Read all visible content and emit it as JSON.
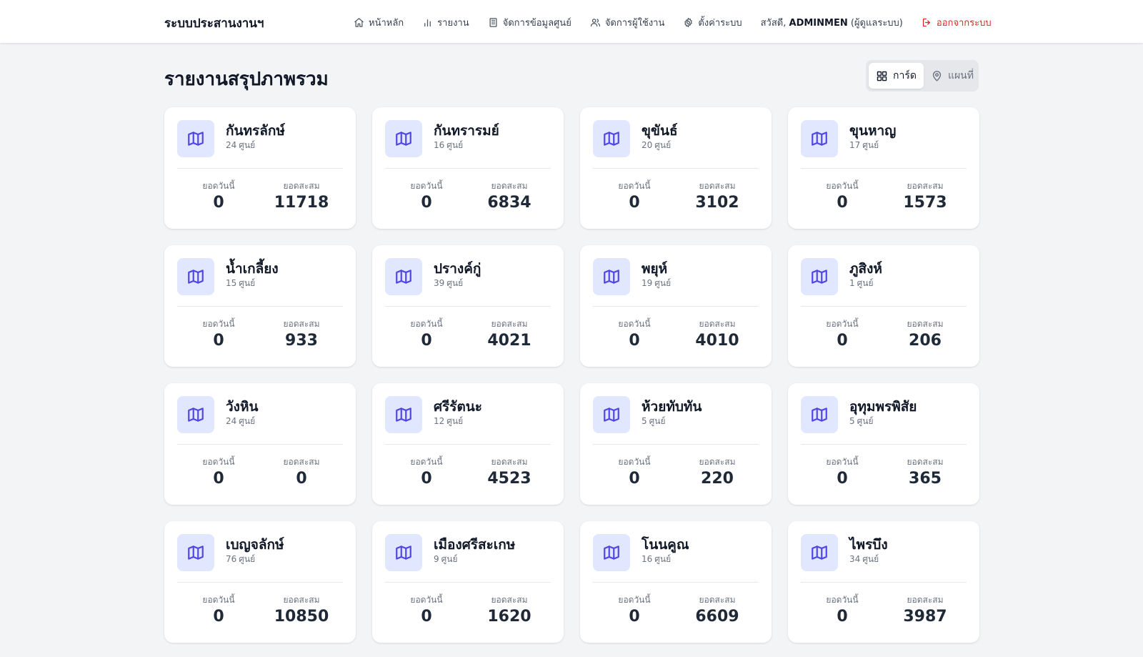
{
  "app": {
    "title": "ระบบประสานงานฯ"
  },
  "nav": {
    "home": "หน้าหลัก",
    "reports": "รายงาน",
    "manage_centers": "จัดการข้อมูลศูนย์",
    "manage_users": "จัดการผู้ใช้งาน",
    "settings": "ตั้งค่าระบบ",
    "greeting_prefix": "สวัสดี,",
    "username": "ADMINMEN",
    "role": "(ผู้ดูแลระบบ)",
    "logout": "ออกจากระบบ"
  },
  "page": {
    "title": "รายงานสรุปภาพรวม",
    "view_card": "การ์ด",
    "view_map": "แผนที่",
    "label_today": "ยอดวันนี้",
    "label_total": "ยอดสะสม",
    "unit_center": "ศูนย์"
  },
  "districts": [
    {
      "name": "กันทรลักษ์",
      "centers": 24,
      "today": 0,
      "total": 11718
    },
    {
      "name": "กันทรารมย์",
      "centers": 16,
      "today": 0,
      "total": 6834
    },
    {
      "name": "ขุขันธ์",
      "centers": 20,
      "today": 0,
      "total": 3102
    },
    {
      "name": "ขุนหาญ",
      "centers": 17,
      "today": 0,
      "total": 1573
    },
    {
      "name": "น้ำเกลี้ยง",
      "centers": 15,
      "today": 0,
      "total": 933
    },
    {
      "name": "ปรางค์กู่",
      "centers": 39,
      "today": 0,
      "total": 4021
    },
    {
      "name": "พยุห์",
      "centers": 19,
      "today": 0,
      "total": 4010
    },
    {
      "name": "ภูสิงห์",
      "centers": 1,
      "today": 0,
      "total": 206
    },
    {
      "name": "วังหิน",
      "centers": 24,
      "today": 0,
      "total": 0
    },
    {
      "name": "ศรีรัตนะ",
      "centers": 12,
      "today": 0,
      "total": 4523
    },
    {
      "name": "ห้วยทับทัน",
      "centers": 5,
      "today": 0,
      "total": 220
    },
    {
      "name": "อุทุมพรพิสัย",
      "centers": 5,
      "today": 0,
      "total": 365
    },
    {
      "name": "เบญจลักษ์",
      "centers": 76,
      "today": 0,
      "total": 10850
    },
    {
      "name": "เมืองศรีสะเกษ",
      "centers": 9,
      "today": 0,
      "total": 1620
    },
    {
      "name": "โนนคูณ",
      "centers": 16,
      "today": 0,
      "total": 6609
    },
    {
      "name": "ไพรบึง",
      "centers": 34,
      "today": 0,
      "total": 3987
    }
  ],
  "colors": {
    "accent": "#4f46e5",
    "icon_bg": "#e0e7ff",
    "logout": "#dc2626",
    "page_bg": "#f3f4f6"
  },
  "icons": {
    "home": "home-icon",
    "reports": "bar-chart-icon",
    "manage_centers": "building-icon",
    "manage_users": "users-icon",
    "settings": "gear-icon",
    "logout": "logout-icon",
    "view_card": "grid-icon",
    "view_map": "map-pin-icon",
    "card": "map-icon"
  }
}
